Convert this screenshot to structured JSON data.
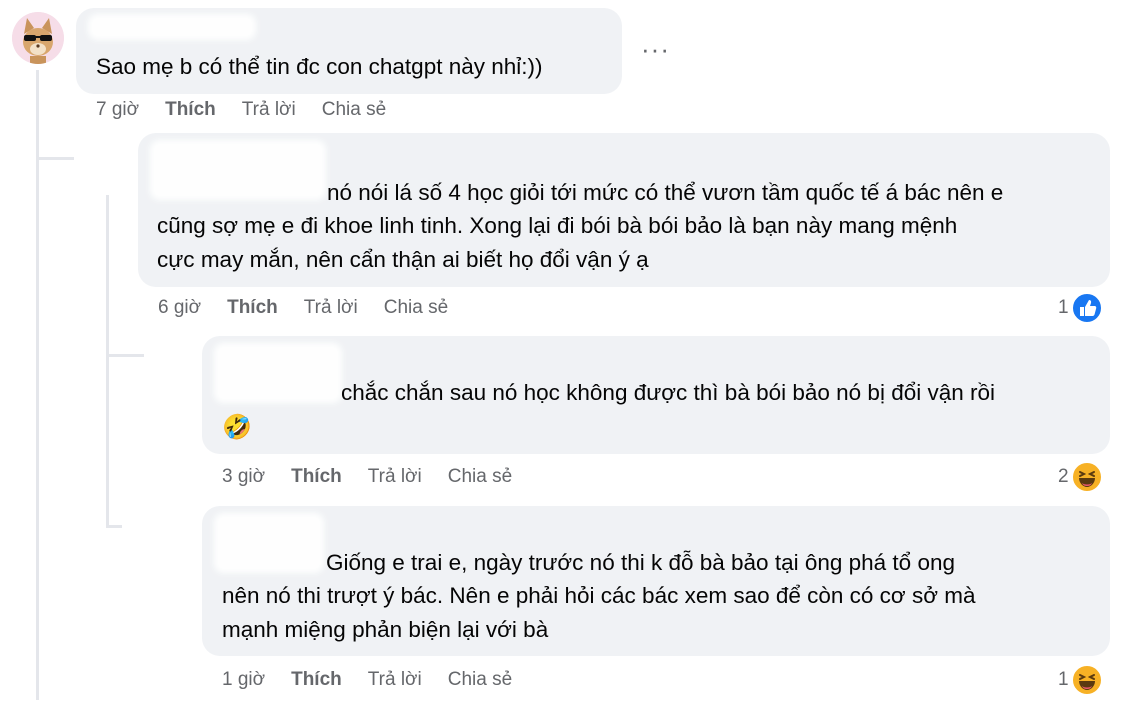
{
  "root_comment": {
    "text": "Sao mẹ b có thể tin đc con chatgpt này nhỉ:))",
    "time": "7 giờ",
    "like_label": "Thích",
    "reply_label": "Trả lời",
    "share_label": "Chia sẻ",
    "more_label": "···"
  },
  "replies": [
    {
      "lines": [
        "nó nói lá số 4 học giỏi tới mức có thể vươn tầm quốc tế á bác nên e",
        "cũng sợ mẹ e đi khoe linh tinh. Xong lại đi bói bà bói bảo là bạn này mang mệnh",
        "cực may mắn, nên cẩn thận ai biết họ đổi vận ý ạ"
      ],
      "time": "6 giờ",
      "like_label": "Thích",
      "reply_label": "Trả lời",
      "share_label": "Chia sẻ",
      "reaction_count": "1",
      "reaction_icon": "like-icon"
    },
    {
      "lines": [
        "chắc chắn sau nó học không được thì bà bói bảo nó bị đổi vận rồi"
      ],
      "emoji": "🤣",
      "time": "3 giờ",
      "like_label": "Thích",
      "reply_label": "Trả lời",
      "share_label": "Chia sẻ",
      "reaction_count": "2",
      "reaction_icon": "haha-icon"
    },
    {
      "lines": [
        "Giống e trai e, ngày trước nó thi k đỗ bà bảo tại ông phá tổ ong",
        "nên nó thi trượt ý bác. Nên e phải hỏi các bác xem sao để còn có cơ sở mà",
        "mạnh miệng phản biện lại với bà"
      ],
      "time": "1 giờ",
      "like_label": "Thích",
      "reply_label": "Trả lời",
      "share_label": "Chia sẻ",
      "reaction_count": "1",
      "reaction_icon": "haha-icon"
    }
  ],
  "colors": {
    "bubble": "#f0f2f5",
    "meta_text": "#65676b",
    "like_blue": "#1877f2",
    "haha_yellow": "#f7b125"
  }
}
